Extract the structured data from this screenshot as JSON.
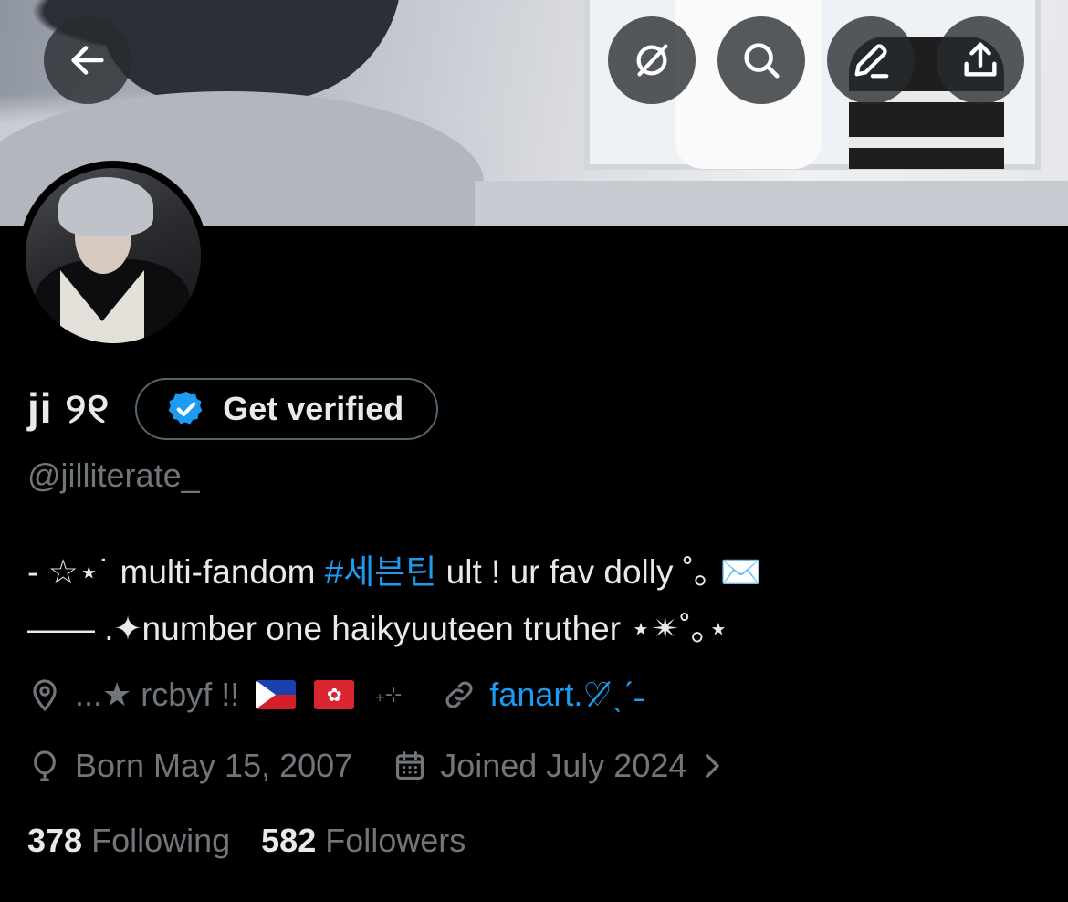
{
  "header": {
    "back_icon": "arrow-left-icon",
    "actions": [
      {
        "icon": "grok-slash-icon"
      },
      {
        "icon": "search-icon"
      },
      {
        "icon": "edit-pencil-icon"
      },
      {
        "icon": "share-upload-icon"
      }
    ]
  },
  "profile": {
    "display_name": "ji ୨୧",
    "verify_button_label": "Get verified",
    "handle": "@jilliterate_",
    "bio_line1_a": "- ☆⋆˙ multi-fandom ",
    "bio_hashtag": "#세븐틴",
    "bio_line1_b": " ult ! ur fav dolly ˚｡ ✉️",
    "bio_line2": "—— .✦number one haikyuuteen truther ⋆✴︎˚｡⋆",
    "location_prefix": "...★ rcbyf !!",
    "location_suffix": "₊⊹",
    "website": "fanart.♡̸ˎˊ˗",
    "born": "Born May 15, 2007",
    "joined": "Joined July 2024",
    "following_count": "378",
    "following_label": "Following",
    "followers_count": "582",
    "followers_label": "Followers"
  },
  "colors": {
    "background": "#000000",
    "text_primary": "#e7e9ea",
    "text_secondary": "#71767b",
    "accent": "#1d9bf0"
  }
}
